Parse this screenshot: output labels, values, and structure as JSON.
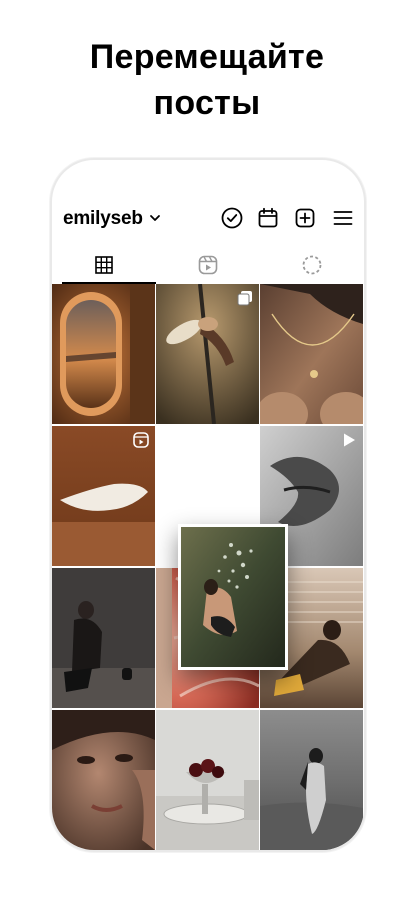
{
  "headline": {
    "line1": "Перемещайте",
    "line2": "посты"
  },
  "profile": {
    "username": "emilyseb",
    "icons": [
      "caret-down-icon",
      "check-circle-icon",
      "calendar-icon",
      "add-square-icon",
      "menu-icon"
    ]
  },
  "tabs": [
    {
      "name": "grid-tab",
      "icon": "grid-icon",
      "active": true
    },
    {
      "name": "reels-tab",
      "icon": "reels-icon",
      "active": false
    },
    {
      "name": "stories-tab",
      "icon": "dashed-circle-icon",
      "active": false
    }
  ],
  "posts": [
    {
      "subject": "airplane window at sunset",
      "badge": null
    },
    {
      "subject": "pole dancer",
      "badge": "carousel-icon"
    },
    {
      "subject": "necklace close-up",
      "badge": null
    },
    {
      "subject": "cream swatch on brown",
      "badge": "reels-icon"
    },
    {
      "subject": "lips close-up",
      "badge": "play-icon"
    },
    {
      "subject": "woman sitting in dark",
      "badge": null
    },
    {
      "subject": "grapefruit macro",
      "badge": null
    },
    {
      "subject": "woman lounging by window",
      "badge": null
    },
    {
      "subject": "face portrait",
      "badge": null
    },
    {
      "subject": "cherries in dish",
      "badge": null
    },
    {
      "subject": "woman at the sea",
      "badge": null
    }
  ],
  "dragged_post": {
    "subject": "swimmer underwater",
    "state": "dragging"
  },
  "colors": {
    "accent": "#000000",
    "border": "#e9e9e9",
    "background": "#ffffff"
  }
}
